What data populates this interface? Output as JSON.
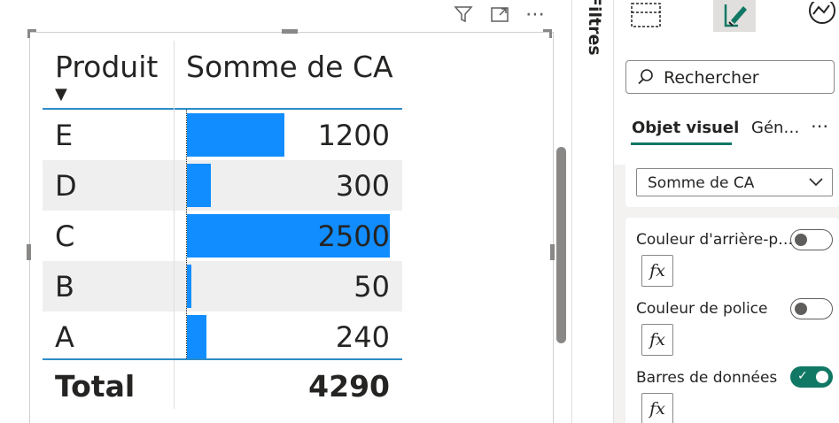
{
  "visual_header": {
    "filter_icon": "filter-icon",
    "focus_icon": "focus-mode-icon",
    "more_icon": "more-options-icon",
    "more_glyph": "⋯"
  },
  "matrix": {
    "headers": {
      "col1": "Produit",
      "col2": "Somme de CA"
    },
    "sort_indicator": "▼",
    "bar_color": "#118dff",
    "max_value": 2500,
    "rows": [
      {
        "label": "E",
        "value": 1200,
        "display": "1200"
      },
      {
        "label": "D",
        "value": 300,
        "display": "300"
      },
      {
        "label": "C",
        "value": 2500,
        "display": "2500"
      },
      {
        "label": "B",
        "value": 50,
        "display": "50"
      },
      {
        "label": "A",
        "value": 240,
        "display": "240"
      }
    ],
    "total": {
      "label": "Total",
      "display": "4290"
    }
  },
  "filters_pane": {
    "label": "Filtres"
  },
  "format_pane": {
    "search_placeholder": "Rechercher",
    "tabs": {
      "visual": "Objet visuel",
      "general": "Gén…",
      "more": "⋯"
    },
    "field_select": {
      "value": "Somme de CA"
    },
    "options": [
      {
        "label": "Couleur d'arrière-p…",
        "toggle": false,
        "fx": "fx"
      },
      {
        "label": "Couleur de police",
        "toggle": false,
        "fx": "fx"
      },
      {
        "label": "Barres de données",
        "toggle": true,
        "fx": "fx",
        "check": "✓"
      }
    ],
    "accent_color": "#117865"
  }
}
